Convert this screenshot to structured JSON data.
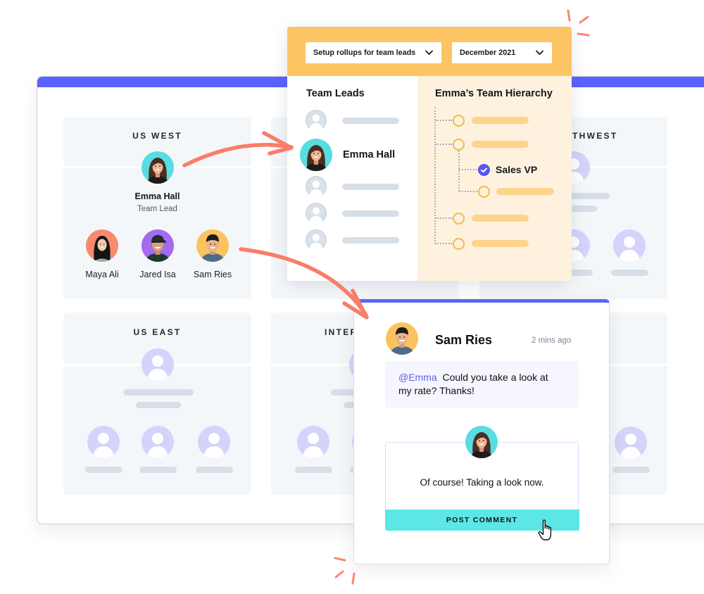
{
  "theme": {
    "accent": "#5B63FE",
    "header_yellow": "#FDC463",
    "hierarchy_bg": "#FEF2DF",
    "button_cyan": "#5CE6E6",
    "arrow_coral": "#FA7D67",
    "mention_color": "#5B5FEF"
  },
  "regions": [
    {
      "label": "US WEST",
      "lead": {
        "name": "Emma Hall",
        "role": "Team Lead"
      },
      "members": [
        {
          "name": "Maya Ali"
        },
        {
          "name": "Jared Isa"
        },
        {
          "name": "Sam Ries"
        }
      ]
    },
    {
      "label": "THWEST",
      "placeholder": true
    },
    {
      "label": "US EAST",
      "placeholder": true
    },
    {
      "label": "INTER",
      "placeholder": true
    }
  ],
  "rollup_panel": {
    "mode_select": "Setup rollups for team leads",
    "period_select": "December 2021",
    "team_leads_title": "Team Leads",
    "team_leads": [
      {
        "placeholder": true
      },
      {
        "name": "Emma Hall",
        "selected": true
      },
      {
        "placeholder": true
      },
      {
        "placeholder": true
      },
      {
        "placeholder": true
      }
    ],
    "hierarchy_title": "Emma’s Team Hierarchy",
    "hierarchy": [
      {
        "level": 1,
        "placeholder": true
      },
      {
        "level": 1,
        "placeholder": true
      },
      {
        "level": 2,
        "label": "Sales VP",
        "checked": true
      },
      {
        "level": 2,
        "placeholder": true
      },
      {
        "level": 1,
        "placeholder": true
      },
      {
        "level": 1,
        "placeholder": true
      }
    ]
  },
  "comment": {
    "author": "Sam Ries",
    "timestamp": "2 mins ago",
    "mention": "@Emma",
    "message": "Could you take a look at my rate? Thanks!",
    "reply_author": "Emma Hall",
    "reply_text": "Of course! Taking a look now.",
    "post_button": "POST COMMENT"
  }
}
